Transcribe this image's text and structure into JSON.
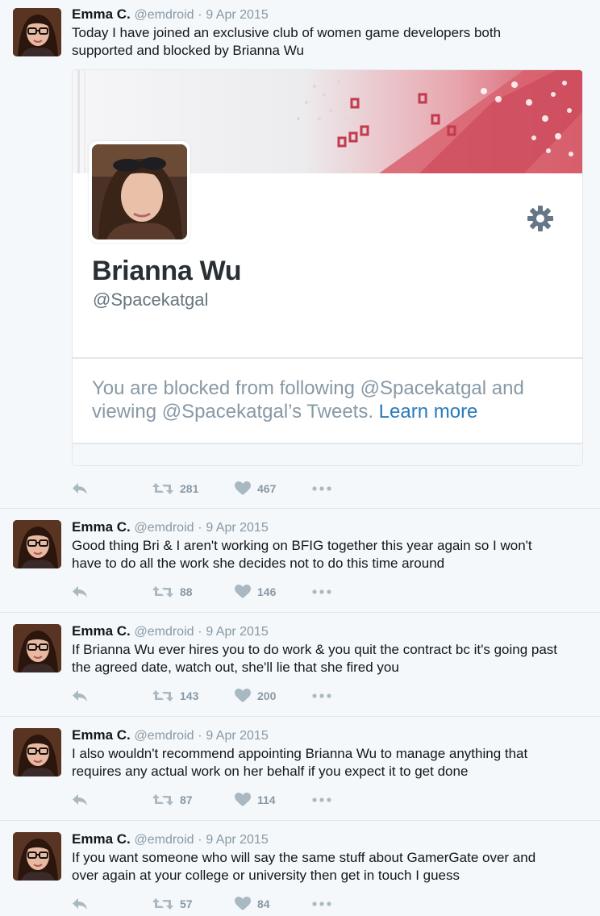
{
  "colors": {
    "background": "#f5f8fa",
    "name": "#14171a",
    "meta": "#8899a6",
    "link": "#2b7bb9",
    "banner_accent": "#d85a68"
  },
  "tweets": [
    {
      "name": "Emma C.",
      "handle": "@emdroid",
      "date": "9 Apr 2015",
      "lines": [
        "Today I have joined an exclusive club of women game developers both",
        "supported and blocked by Brianna Wu"
      ],
      "retweets": "281",
      "likes": "467"
    },
    {
      "name": "Emma C.",
      "handle": "@emdroid",
      "date": "9 Apr 2015",
      "lines": [
        "Good thing Bri & I aren't working on BFIG together this year again so I won't",
        "have to do all the work she decides not to do this time around"
      ],
      "retweets": "88",
      "likes": "146"
    },
    {
      "name": "Emma C.",
      "handle": "@emdroid",
      "date": "9 Apr 2015",
      "lines": [
        "If Brianna Wu ever hires you to do work & you quit the contract bc it's going past",
        "the agreed date, watch out, she'll lie that she fired you"
      ],
      "retweets": "143",
      "likes": "200"
    },
    {
      "name": "Emma C.",
      "handle": "@emdroid",
      "date": "9 Apr 2015",
      "lines": [
        "I also wouldn't recommend appointing Brianna Wu to manage anything that",
        "requires any actual work on her behalf if you expect it to get done"
      ],
      "retweets": "87",
      "likes": "114"
    },
    {
      "name": "Emma C.",
      "handle": "@emdroid",
      "date": "9 Apr 2015",
      "lines": [
        "If you want someone who will say the same stuff about GamerGate over and",
        "over again at your college or university then get in touch I guess"
      ],
      "retweets": "57",
      "likes": "84"
    }
  ],
  "embedded_card": {
    "profile_name": "Brianna Wu",
    "profile_handle": "@Spacekatgal",
    "blocked_line1": "You are blocked from following @Spacekatgal and",
    "blocked_line2": "viewing @Spacekatgal’s Tweets.",
    "learn_more": "Learn more",
    "gear_icon": "gear-icon"
  },
  "icons": {
    "reply": "reply-icon",
    "retweet": "retweet-icon",
    "like": "heart-icon",
    "more": "more-icon"
  }
}
